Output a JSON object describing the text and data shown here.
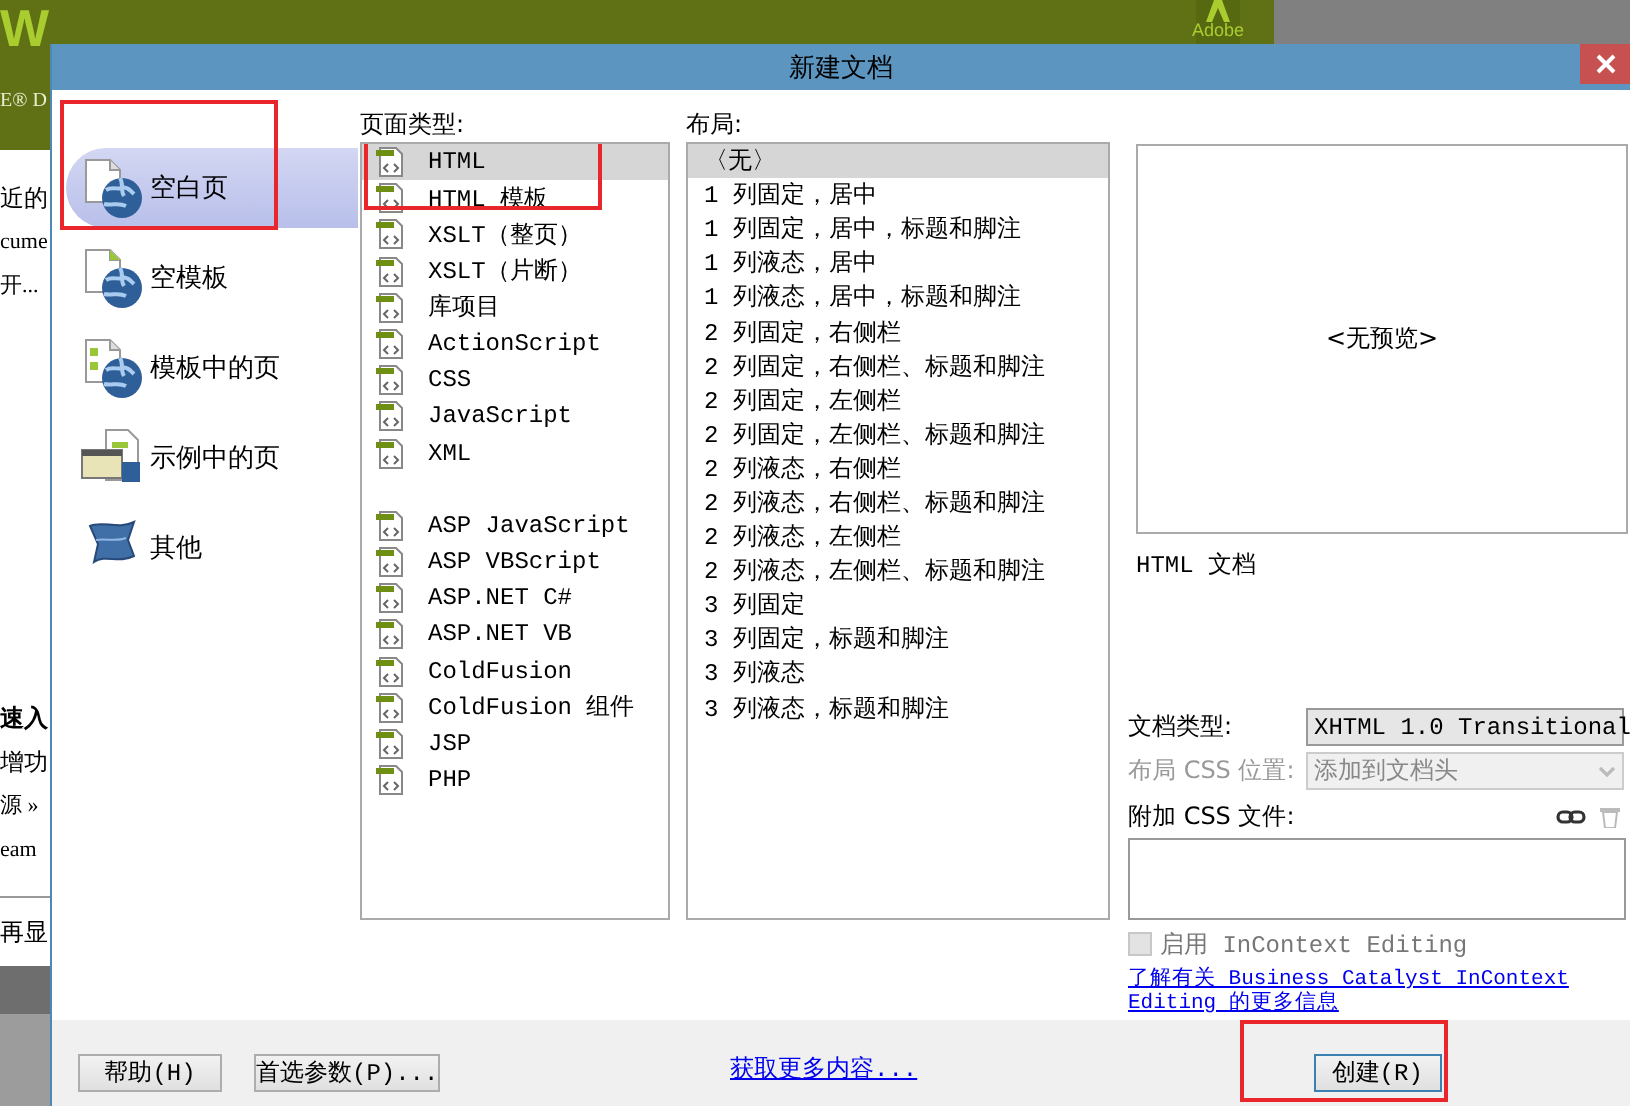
{
  "backdrop": {
    "banner_letter": "W",
    "banner_tagline": "E® D",
    "brand": "Adobe",
    "lines": [
      {
        "text": "近的",
        "bold": false
      },
      {
        "text": "cume",
        "bold": false
      },
      {
        "text": "开...",
        "bold": false
      },
      {
        "text": "速入",
        "bold": true
      },
      {
        "text": "增功",
        "bold": false
      },
      {
        "text": "源 »",
        "bold": false
      },
      {
        "text": "eam",
        "bold": false
      },
      {
        "text": "再显",
        "bold": false
      }
    ]
  },
  "window": {
    "title": "新建文档"
  },
  "categories": [
    {
      "label": "空白页",
      "kind": "blank",
      "selected": true,
      "highlighted": true
    },
    {
      "label": "空模板",
      "kind": "template",
      "selected": false,
      "highlighted": false
    },
    {
      "label": "模板中的页",
      "kind": "fromtemplate",
      "selected": false,
      "highlighted": false
    },
    {
      "label": "示例中的页",
      "kind": "sample",
      "selected": false,
      "highlighted": false
    },
    {
      "label": "其他",
      "kind": "other",
      "selected": false,
      "highlighted": false
    }
  ],
  "page_types": {
    "label": "页面类型:",
    "groups": [
      {
        "items": [
          {
            "label": "HTML",
            "selected": true,
            "highlighted": true
          },
          {
            "label": "HTML 模板",
            "selected": false,
            "highlighted": true
          },
          {
            "label": "XSLT（整页）",
            "selected": false,
            "highlighted": false
          },
          {
            "label": "XSLT（片断）",
            "selected": false,
            "highlighted": false
          },
          {
            "label": "库项目",
            "selected": false,
            "highlighted": false
          },
          {
            "label": "ActionScript",
            "selected": false,
            "highlighted": false
          },
          {
            "label": "CSS",
            "selected": false,
            "highlighted": false
          },
          {
            "label": "JavaScript",
            "selected": false,
            "highlighted": false
          },
          {
            "label": "XML",
            "selected": false,
            "highlighted": false
          }
        ]
      },
      {
        "items": [
          {
            "label": "ASP JavaScript",
            "selected": false,
            "highlighted": false
          },
          {
            "label": "ASP VBScript",
            "selected": false,
            "highlighted": false
          },
          {
            "label": "ASP.NET C#",
            "selected": false,
            "highlighted": false
          },
          {
            "label": "ASP.NET VB",
            "selected": false,
            "highlighted": false
          },
          {
            "label": "ColdFusion",
            "selected": false,
            "highlighted": false
          },
          {
            "label": "ColdFusion 组件",
            "selected": false,
            "highlighted": false
          },
          {
            "label": "JSP",
            "selected": false,
            "highlighted": false
          },
          {
            "label": "PHP",
            "selected": false,
            "highlighted": false
          }
        ]
      }
    ]
  },
  "layouts": {
    "label": "布局:",
    "groups": [
      {
        "items": [
          {
            "label": "〈无〉",
            "selected": true,
            "highlighted": false
          },
          {
            "label": "1 列固定，居中",
            "selected": false,
            "highlighted": false
          },
          {
            "label": "1 列固定，居中，标题和脚注",
            "selected": false,
            "highlighted": false
          },
          {
            "label": "1 列液态，居中",
            "selected": false,
            "highlighted": false
          },
          {
            "label": "1 列液态，居中，标题和脚注",
            "selected": false,
            "highlighted": false
          },
          {
            "label": "2 列固定，右侧栏",
            "selected": false,
            "highlighted": false
          },
          {
            "label": "2 列固定，右侧栏、标题和脚注",
            "selected": false,
            "highlighted": false
          },
          {
            "label": "2 列固定，左侧栏",
            "selected": false,
            "highlighted": false
          },
          {
            "label": "2 列固定，左侧栏、标题和脚注",
            "selected": false,
            "highlighted": false
          },
          {
            "label": "2 列液态，右侧栏",
            "selected": false,
            "highlighted": false
          },
          {
            "label": "2 列液态，右侧栏、标题和脚注",
            "selected": false,
            "highlighted": false
          },
          {
            "label": "2 列液态，左侧栏",
            "selected": false,
            "highlighted": false
          },
          {
            "label": "2 列液态，左侧栏、标题和脚注",
            "selected": false,
            "highlighted": false
          },
          {
            "label": "3 列固定",
            "selected": false,
            "highlighted": false
          },
          {
            "label": "3 列固定，标题和脚注",
            "selected": false,
            "highlighted": false
          },
          {
            "label": "3 列液态",
            "selected": false,
            "highlighted": false
          },
          {
            "label": "3 列液态，标题和脚注",
            "selected": false,
            "highlighted": false
          }
        ]
      }
    ]
  },
  "preview": {
    "text": "<无预览>",
    "description": "HTML 文档"
  },
  "doc_type": {
    "label": "文档类型:",
    "value": "XHTML 1.0 Transitional",
    "disabled": false
  },
  "css_position": {
    "label": "布局 CSS 位置:",
    "value": "添加到文档头",
    "disabled": true
  },
  "attach_css": {
    "label": "附加 CSS 文件:"
  },
  "incontext": {
    "label": "启用 InContext Editing",
    "checked": false,
    "disabled": true
  },
  "learn_more_link": "了解有关 Business Catalyst InContext Editing 的更多信息",
  "footer": {
    "buttons": [
      {
        "label": "帮助(H)"
      },
      {
        "label": "首选参数(P)..."
      }
    ],
    "link": "获取更多内容...",
    "primary": {
      "label": "创建(R)",
      "highlighted": true
    }
  }
}
